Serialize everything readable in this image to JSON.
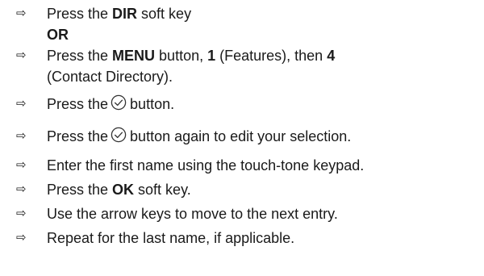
{
  "icons": {
    "bullet": "⇨",
    "button_icon": "circle-check-icon"
  },
  "steps": [
    {
      "pre": "Press the ",
      "bold": "DIR",
      "post": " soft key",
      "or_label": "OR"
    },
    {
      "pre": "Press the ",
      "bold1": "MENU",
      "mid1": " button, ",
      "bold2": "1",
      "mid2": " (Features), then ",
      "bold3": "4",
      "line2": "(Contact Directory)."
    },
    {
      "pre": "Press the",
      "post": "button."
    },
    {
      "pre": "Press the",
      "post": "button again to edit your selection."
    },
    {
      "text": "Enter the first name using the touch-tone keypad."
    },
    {
      "pre": "Press the ",
      "bold": "OK",
      "post": " soft key."
    },
    {
      "text": "Use the arrow keys to move to the next entry."
    },
    {
      "text": "Repeat for the last name, if applicable."
    }
  ]
}
